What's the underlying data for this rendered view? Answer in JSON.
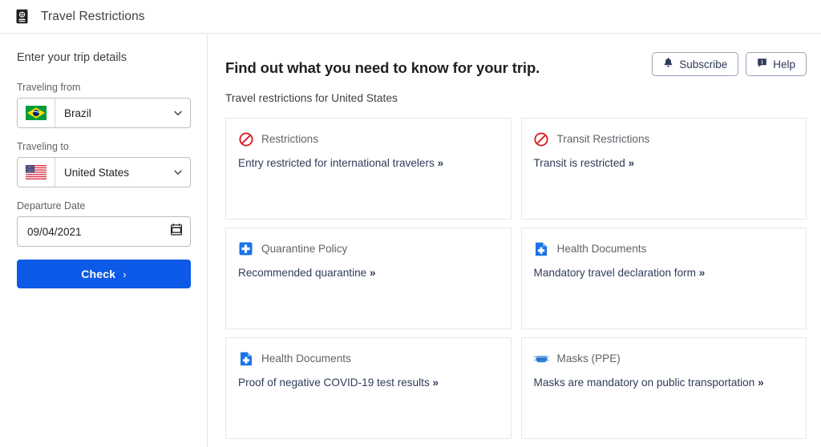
{
  "window": {
    "title": "Travel Restrictions",
    "icon": "passport-icon"
  },
  "sidebar": {
    "heading": "Enter your trip details",
    "from": {
      "label": "Traveling from",
      "value": "Brazil",
      "flag": "brazil-flag"
    },
    "to": {
      "label": "Traveling to",
      "value": "United States",
      "flag": "united-states-flag"
    },
    "departure": {
      "label": "Departure Date",
      "value": "09/04/2021",
      "placeholder": "mm/dd/yyyy",
      "icon": "calendar-icon"
    },
    "submit": {
      "label": "Check",
      "arrow": "›"
    }
  },
  "main": {
    "title": "Find out what you need to know for your trip.",
    "subtitle": "Travel restrictions for United States",
    "actions": [
      {
        "label": "Subscribe",
        "icon": "bell-icon"
      },
      {
        "label": "Help",
        "icon": "comment-icon"
      }
    ],
    "cards": [
      {
        "title": "Restrictions",
        "icon": "no-entry-icon",
        "link": "Entry restricted for international travelers",
        "chevrons": "»"
      },
      {
        "title": "Transit Restrictions",
        "icon": "no-entry-icon",
        "link": "Transit is restricted",
        "chevrons": "»"
      },
      {
        "title": "Quarantine Policy",
        "icon": "medical-cross-icon",
        "link": "Recommended quarantine",
        "chevrons": "»"
      },
      {
        "title": "Health Documents",
        "icon": "medical-document-icon",
        "link": "Mandatory travel declaration form",
        "chevrons": "»"
      },
      {
        "title": "Health Documents",
        "icon": "medical-document-icon",
        "link": "Proof of negative COVID-19 test results",
        "chevrons": "»"
      },
      {
        "title": "Masks (PPE)",
        "icon": "face-mask-icon",
        "link": "Masks are mandatory on public transportation",
        "chevrons": "»"
      }
    ]
  },
  "colors": {
    "primary": "#0d59e8",
    "danger": "#d81f26",
    "accent_blue": "#1a73e8",
    "navy": "#2f3b59",
    "muted": "#5f6368"
  }
}
